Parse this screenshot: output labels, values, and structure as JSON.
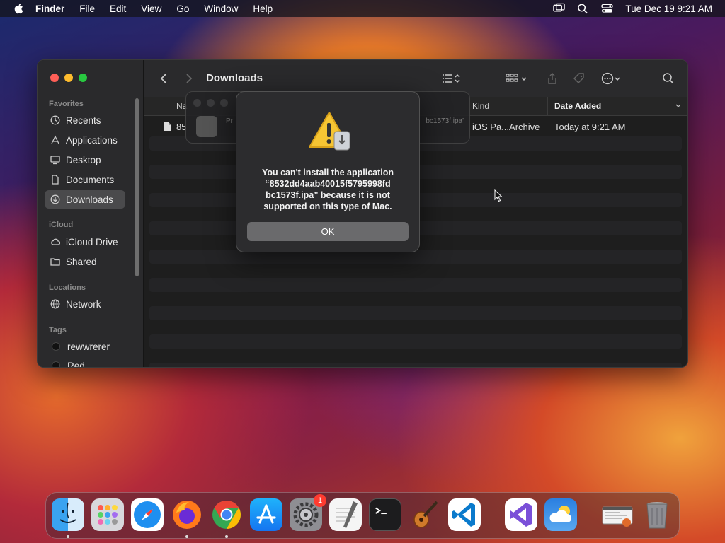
{
  "menubar": {
    "app": "Finder",
    "items": [
      "File",
      "Edit",
      "View",
      "Go",
      "Window",
      "Help"
    ],
    "datetime": "Tue Dec 19  9:21 AM"
  },
  "finder": {
    "title": "Downloads",
    "sidebar": {
      "favorites_header": "Favorites",
      "favorites": [
        "Recents",
        "Applications",
        "Desktop",
        "Documents",
        "Downloads"
      ],
      "icloud_header": "iCloud",
      "icloud": [
        "iCloud Drive",
        "Shared"
      ],
      "locations_header": "Locations",
      "locations": [
        "Network"
      ],
      "tags_header": "Tags",
      "tags": [
        "rewwrerer",
        "Red"
      ]
    },
    "columns": {
      "name": "Na",
      "kind": "Kind",
      "date_added": "Date Added"
    },
    "row": {
      "name": "85",
      "kind": "iOS Pa...Archive",
      "date_added": "Today at 9:21 AM"
    }
  },
  "progress_panel": {
    "label": "Pr",
    "filename": "bc1573f.ipa'"
  },
  "alert": {
    "line1": "You can't install the application",
    "line2": "“8532dd4aab40015f5795998fd",
    "line3": "bc1573f.ipa” because it is not",
    "line4": "supported on this type of Mac.",
    "ok_label": "OK"
  },
  "dock": {
    "badge_count": "1",
    "apps": [
      "Finder",
      "Launchpad",
      "Safari",
      "Firefox",
      "Chrome",
      "App Store",
      "System Settings",
      "TextEdit",
      "Terminal",
      "GarageBand",
      "Visual Studio Code",
      "Visual Studio",
      "Weather",
      "Preview",
      "Trash"
    ]
  }
}
